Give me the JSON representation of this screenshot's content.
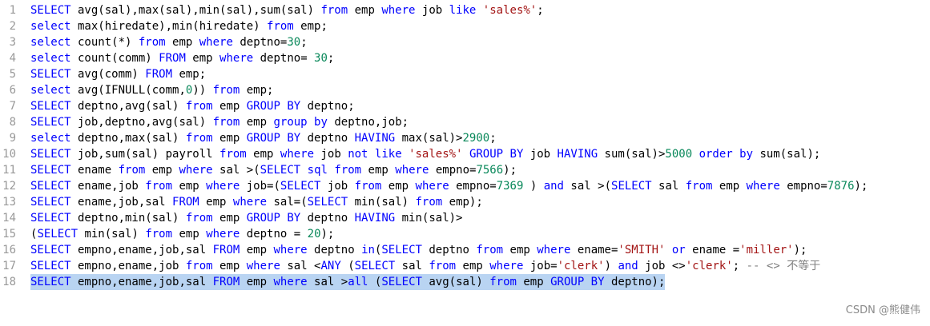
{
  "colors": {
    "keyword": "#0000ff",
    "string": "#a31515",
    "number": "#09885a",
    "comment": "#808080",
    "line_number": "#999999",
    "selection": "#b9d4f2"
  },
  "lines": [
    {
      "n": "1",
      "tokens": [
        {
          "t": "k",
          "v": "SELECT"
        },
        {
          "t": "p",
          "v": " avg(sal),max(sal),min(sal),sum(sal) "
        },
        {
          "t": "k",
          "v": "from"
        },
        {
          "t": "p",
          "v": " emp "
        },
        {
          "t": "k",
          "v": "where"
        },
        {
          "t": "p",
          "v": " job "
        },
        {
          "t": "k",
          "v": "like"
        },
        {
          "t": "p",
          "v": " "
        },
        {
          "t": "s",
          "v": "'sales%'"
        },
        {
          "t": "p",
          "v": ";"
        }
      ]
    },
    {
      "n": "2",
      "tokens": [
        {
          "t": "k",
          "v": "select"
        },
        {
          "t": "p",
          "v": " max(hiredate),min(hiredate) "
        },
        {
          "t": "k",
          "v": "from"
        },
        {
          "t": "p",
          "v": " emp;"
        }
      ]
    },
    {
      "n": "3",
      "tokens": [
        {
          "t": "k",
          "v": "select"
        },
        {
          "t": "p",
          "v": " count(*) "
        },
        {
          "t": "k",
          "v": "from"
        },
        {
          "t": "p",
          "v": " emp "
        },
        {
          "t": "k",
          "v": "where"
        },
        {
          "t": "p",
          "v": " deptno="
        },
        {
          "t": "n",
          "v": "30"
        },
        {
          "t": "p",
          "v": ";"
        }
      ]
    },
    {
      "n": "4",
      "tokens": [
        {
          "t": "k",
          "v": "select"
        },
        {
          "t": "p",
          "v": " count(comm) "
        },
        {
          "t": "k",
          "v": "FROM"
        },
        {
          "t": "p",
          "v": " emp "
        },
        {
          "t": "k",
          "v": "where"
        },
        {
          "t": "p",
          "v": " deptno= "
        },
        {
          "t": "n",
          "v": "30"
        },
        {
          "t": "p",
          "v": ";"
        }
      ]
    },
    {
      "n": "5",
      "tokens": [
        {
          "t": "k",
          "v": "SELECT"
        },
        {
          "t": "p",
          "v": " avg(comm) "
        },
        {
          "t": "k",
          "v": "FROM"
        },
        {
          "t": "p",
          "v": " emp;"
        }
      ]
    },
    {
      "n": "6",
      "tokens": [
        {
          "t": "k",
          "v": "select"
        },
        {
          "t": "p",
          "v": " avg(IFNULL(comm,"
        },
        {
          "t": "n",
          "v": "0"
        },
        {
          "t": "p",
          "v": ")) "
        },
        {
          "t": "k",
          "v": "from"
        },
        {
          "t": "p",
          "v": " emp;"
        }
      ]
    },
    {
      "n": "7",
      "tokens": [
        {
          "t": "k",
          "v": "SELECT"
        },
        {
          "t": "p",
          "v": " deptno,avg(sal) "
        },
        {
          "t": "k",
          "v": "from"
        },
        {
          "t": "p",
          "v": " emp "
        },
        {
          "t": "k",
          "v": "GROUP BY"
        },
        {
          "t": "p",
          "v": " deptno;"
        }
      ]
    },
    {
      "n": "8",
      "tokens": [
        {
          "t": "k",
          "v": "SELECT"
        },
        {
          "t": "p",
          "v": " job,deptno,avg(sal) "
        },
        {
          "t": "k",
          "v": "from"
        },
        {
          "t": "p",
          "v": " emp "
        },
        {
          "t": "k",
          "v": "group by"
        },
        {
          "t": "p",
          "v": " deptno,job;"
        }
      ]
    },
    {
      "n": "9",
      "tokens": [
        {
          "t": "k",
          "v": "select"
        },
        {
          "t": "p",
          "v": " deptno,max(sal) "
        },
        {
          "t": "k",
          "v": "from"
        },
        {
          "t": "p",
          "v": " emp "
        },
        {
          "t": "k",
          "v": "GROUP BY"
        },
        {
          "t": "p",
          "v": " deptno "
        },
        {
          "t": "k",
          "v": "HAVING"
        },
        {
          "t": "p",
          "v": " max(sal)>"
        },
        {
          "t": "n",
          "v": "2900"
        },
        {
          "t": "p",
          "v": ";"
        }
      ]
    },
    {
      "n": "10",
      "tokens": [
        {
          "t": "k",
          "v": "SELECT"
        },
        {
          "t": "p",
          "v": " job,sum(sal) payroll "
        },
        {
          "t": "k",
          "v": "from"
        },
        {
          "t": "p",
          "v": " emp "
        },
        {
          "t": "k",
          "v": "where"
        },
        {
          "t": "p",
          "v": " job "
        },
        {
          "t": "k",
          "v": "not like"
        },
        {
          "t": "p",
          "v": " "
        },
        {
          "t": "s",
          "v": "'sales%'"
        },
        {
          "t": "p",
          "v": " "
        },
        {
          "t": "k",
          "v": "GROUP BY"
        },
        {
          "t": "p",
          "v": " job "
        },
        {
          "t": "k",
          "v": "HAVING"
        },
        {
          "t": "p",
          "v": " sum(sal)>"
        },
        {
          "t": "n",
          "v": "5000"
        },
        {
          "t": "p",
          "v": " "
        },
        {
          "t": "k",
          "v": "order by"
        },
        {
          "t": "p",
          "v": " sum(sal);"
        }
      ]
    },
    {
      "n": "11",
      "tokens": [
        {
          "t": "k",
          "v": "SELECT"
        },
        {
          "t": "p",
          "v": " ename "
        },
        {
          "t": "k",
          "v": "from"
        },
        {
          "t": "p",
          "v": " emp "
        },
        {
          "t": "k",
          "v": "where"
        },
        {
          "t": "p",
          "v": " sal >("
        },
        {
          "t": "k",
          "v": "SELECT"
        },
        {
          "t": "p",
          "v": " "
        },
        {
          "t": "k",
          "v": "sql"
        },
        {
          "t": "p",
          "v": " "
        },
        {
          "t": "k",
          "v": "from"
        },
        {
          "t": "p",
          "v": " emp "
        },
        {
          "t": "k",
          "v": "where"
        },
        {
          "t": "p",
          "v": " empno="
        },
        {
          "t": "n",
          "v": "7566"
        },
        {
          "t": "p",
          "v": ");"
        }
      ]
    },
    {
      "n": "12",
      "tokens": [
        {
          "t": "k",
          "v": "SELECT"
        },
        {
          "t": "p",
          "v": " ename,job "
        },
        {
          "t": "k",
          "v": "from"
        },
        {
          "t": "p",
          "v": " emp "
        },
        {
          "t": "k",
          "v": "where"
        },
        {
          "t": "p",
          "v": " job=("
        },
        {
          "t": "k",
          "v": "SELECT"
        },
        {
          "t": "p",
          "v": " job "
        },
        {
          "t": "k",
          "v": "from"
        },
        {
          "t": "p",
          "v": " emp "
        },
        {
          "t": "k",
          "v": "where"
        },
        {
          "t": "p",
          "v": " empno="
        },
        {
          "t": "n",
          "v": "7369"
        },
        {
          "t": "p",
          "v": " ) "
        },
        {
          "t": "k",
          "v": "and"
        },
        {
          "t": "p",
          "v": " sal >("
        },
        {
          "t": "k",
          "v": "SELECT"
        },
        {
          "t": "p",
          "v": " sal "
        },
        {
          "t": "k",
          "v": "from"
        },
        {
          "t": "p",
          "v": " emp "
        },
        {
          "t": "k",
          "v": "where"
        },
        {
          "t": "p",
          "v": " empno="
        },
        {
          "t": "n",
          "v": "7876"
        },
        {
          "t": "p",
          "v": ");"
        }
      ]
    },
    {
      "n": "13",
      "tokens": [
        {
          "t": "k",
          "v": "SELECT"
        },
        {
          "t": "p",
          "v": " ename,job,sal "
        },
        {
          "t": "k",
          "v": "FROM"
        },
        {
          "t": "p",
          "v": " emp "
        },
        {
          "t": "k",
          "v": "where"
        },
        {
          "t": "p",
          "v": " sal=("
        },
        {
          "t": "k",
          "v": "SELECT"
        },
        {
          "t": "p",
          "v": " min(sal) "
        },
        {
          "t": "k",
          "v": "from"
        },
        {
          "t": "p",
          "v": " emp);"
        }
      ]
    },
    {
      "n": "14",
      "tokens": [
        {
          "t": "k",
          "v": "SELECT"
        },
        {
          "t": "p",
          "v": " deptno,min(sal) "
        },
        {
          "t": "k",
          "v": "from"
        },
        {
          "t": "p",
          "v": " emp "
        },
        {
          "t": "k",
          "v": "GROUP BY"
        },
        {
          "t": "p",
          "v": " deptno "
        },
        {
          "t": "k",
          "v": "HAVING"
        },
        {
          "t": "p",
          "v": " min(sal)>"
        }
      ]
    },
    {
      "n": "15",
      "tokens": [
        {
          "t": "p",
          "v": "("
        },
        {
          "t": "k",
          "v": "SELECT"
        },
        {
          "t": "p",
          "v": " min(sal) "
        },
        {
          "t": "k",
          "v": "from"
        },
        {
          "t": "p",
          "v": " emp "
        },
        {
          "t": "k",
          "v": "where"
        },
        {
          "t": "p",
          "v": " deptno = "
        },
        {
          "t": "n",
          "v": "20"
        },
        {
          "t": "p",
          "v": ");"
        }
      ]
    },
    {
      "n": "16",
      "tokens": [
        {
          "t": "k",
          "v": "SELECT"
        },
        {
          "t": "p",
          "v": " empno,ename,job,sal "
        },
        {
          "t": "k",
          "v": "FROM"
        },
        {
          "t": "p",
          "v": " emp "
        },
        {
          "t": "k",
          "v": "where"
        },
        {
          "t": "p",
          "v": " deptno "
        },
        {
          "t": "k",
          "v": "in"
        },
        {
          "t": "p",
          "v": "("
        },
        {
          "t": "k",
          "v": "SELECT"
        },
        {
          "t": "p",
          "v": " deptno "
        },
        {
          "t": "k",
          "v": "from"
        },
        {
          "t": "p",
          "v": " emp "
        },
        {
          "t": "k",
          "v": "where"
        },
        {
          "t": "p",
          "v": " ename="
        },
        {
          "t": "s",
          "v": "'SMITH'"
        },
        {
          "t": "p",
          "v": " "
        },
        {
          "t": "k",
          "v": "or"
        },
        {
          "t": "p",
          "v": " ename ="
        },
        {
          "t": "s",
          "v": "'miller'"
        },
        {
          "t": "p",
          "v": ");"
        }
      ]
    },
    {
      "n": "17",
      "tokens": [
        {
          "t": "k",
          "v": "SELECT"
        },
        {
          "t": "p",
          "v": " empno,ename,job "
        },
        {
          "t": "k",
          "v": "from"
        },
        {
          "t": "p",
          "v": " emp "
        },
        {
          "t": "k",
          "v": "where"
        },
        {
          "t": "p",
          "v": " sal <"
        },
        {
          "t": "k",
          "v": "ANY"
        },
        {
          "t": "p",
          "v": " ("
        },
        {
          "t": "k",
          "v": "SELECT"
        },
        {
          "t": "p",
          "v": " sal "
        },
        {
          "t": "k",
          "v": "from"
        },
        {
          "t": "p",
          "v": " emp "
        },
        {
          "t": "k",
          "v": "where"
        },
        {
          "t": "p",
          "v": " job="
        },
        {
          "t": "s",
          "v": "'clerk'"
        },
        {
          "t": "p",
          "v": ") "
        },
        {
          "t": "k",
          "v": "and"
        },
        {
          "t": "p",
          "v": " job <>"
        },
        {
          "t": "s",
          "v": "'clerk'"
        },
        {
          "t": "p",
          "v": "; "
        },
        {
          "t": "c",
          "v": "-- <> 不等于"
        }
      ]
    },
    {
      "n": "18",
      "selected": true,
      "tokens": [
        {
          "t": "k",
          "v": "SELECT"
        },
        {
          "t": "p",
          "v": " empno,ename,job,sal "
        },
        {
          "t": "k",
          "v": "FROM"
        },
        {
          "t": "p",
          "v": " emp "
        },
        {
          "t": "k",
          "v": "where"
        },
        {
          "t": "p",
          "v": " sal >"
        },
        {
          "t": "k",
          "v": "all"
        },
        {
          "t": "p",
          "v": " ("
        },
        {
          "t": "k",
          "v": "SELECT"
        },
        {
          "t": "p",
          "v": " avg(sal) "
        },
        {
          "t": "k",
          "v": "from"
        },
        {
          "t": "p",
          "v": " emp "
        },
        {
          "t": "k",
          "v": "GROUP BY"
        },
        {
          "t": "p",
          "v": " deptno);"
        }
      ]
    }
  ],
  "watermark": "CSDN @熊健伟"
}
